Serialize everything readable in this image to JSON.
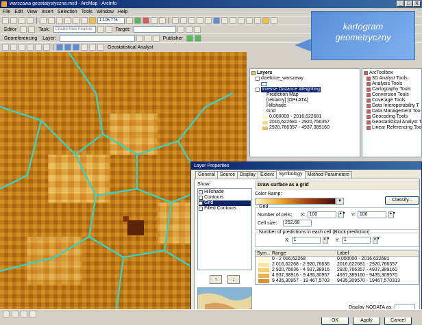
{
  "app": {
    "title": "warszawa geostatystyczna.mxd - ArcMap - ArcInfo",
    "min_label": "_",
    "max_label": "□",
    "close_label": "X"
  },
  "menu": [
    "File",
    "Edit",
    "View",
    "Insert",
    "Selection",
    "Tools",
    "Window",
    "Help"
  ],
  "toolbar": {
    "scale": "1:105 776",
    "editor_label": "Editor",
    "task_label": "Task:",
    "task_value": "Create New Feature",
    "target_label": "Target:",
    "georef_label": "Georeferencing",
    "layer_label": "Layer:",
    "publisher_label": "Publisher",
    "geostat_label": "Geostatistical Analyst"
  },
  "callout": {
    "line1": "kartogram",
    "line2": "geometryczny"
  },
  "toc": {
    "root": "Layers",
    "items": [
      {
        "label": "dzielnice_warszawy",
        "indent": 1
      },
      {
        "label": "",
        "indent": 2
      },
      {
        "label": "Inverse Distance Weighting",
        "indent": 1,
        "selected": true
      },
      {
        "label": "Prediction Map",
        "indent": 3
      },
      {
        "label": "[reklamy] [OPŁATA]",
        "indent": 3
      },
      {
        "label": "Hillshade",
        "indent": 3
      },
      {
        "label": "Grid",
        "indent": 3
      }
    ],
    "classes": [
      {
        "label": "0,000000 - 2016,622681",
        "color": "#fff6c0"
      },
      {
        "label": "2016,622681 - 2920,766357",
        "color": "#f5de8a"
      },
      {
        "label": "2920,766357 - 4937,389160",
        "color": "#e8c060"
      }
    ]
  },
  "arctoolbox": {
    "title": "ArcToolbox",
    "items": [
      "3D Analyst Tools",
      "Analysis Tools",
      "Cartography Tools",
      "Conversion Tools",
      "Coverage Tools",
      "Data Interoperability T",
      "Data Management Too",
      "Geocoding Tools",
      "Geostatistical Analyst T",
      "Linear Referencing Too"
    ]
  },
  "dialog": {
    "title": "Layer Properties",
    "tabs": [
      "General",
      "Source",
      "Display",
      "Extent",
      "Symbology",
      "Method Parameters"
    ],
    "show_label": "Show:",
    "show_items": [
      {
        "label": "Hillshade",
        "checked": true
      },
      {
        "label": "Contours",
        "checked": false
      },
      {
        "label": "Grid",
        "checked": true,
        "selected": true
      },
      {
        "label": "Filled Contours",
        "checked": false
      }
    ],
    "header": "Draw surface as a grid",
    "color_ramp_label": "Color Ramp:",
    "classify_label": "Classify...",
    "grid_group": "Grid",
    "cells_label": "Number of cells:",
    "x_label": "X:",
    "y_label": "Y:",
    "cells_x": "100",
    "cells_y": "106",
    "cell_size_label": "Cell size:",
    "cell_size": "252,68",
    "block_group": "Number of predictions in each cell (Block prediction)",
    "block_x": "1",
    "block_y": "1",
    "table_head": {
      "sym": "Sym...",
      "range": "Range",
      "label": "Label"
    },
    "rows": [
      {
        "range": "0 - 2 016,62268",
        "label": "0,000000 - 2016,622681",
        "color": "#fff8d0"
      },
      {
        "range": "2 016,62268 - 2 920,76636",
        "label": "2016,622681 - 2920,766357",
        "color": "#fbe8a0"
      },
      {
        "range": "2 920,76636 - 4 937,38916",
        "label": "2920,766357 - 4937,389160",
        "color": "#f3cf70"
      },
      {
        "range": "4 937,38916 - 9 435,30957",
        "label": "4937,389160 - 9435,309570",
        "color": "#e8b048"
      },
      {
        "range": "9 435,30957 - 19 467,5703",
        "label": "9435,309570 - 19467,570313",
        "color": "#d89030"
      }
    ],
    "nodata_label": "Display NODATA as:",
    "ok_label": "OK",
    "apply_label": "Apply",
    "cancel_label": "Cancel"
  },
  "statusbar": {
    "text": ""
  }
}
